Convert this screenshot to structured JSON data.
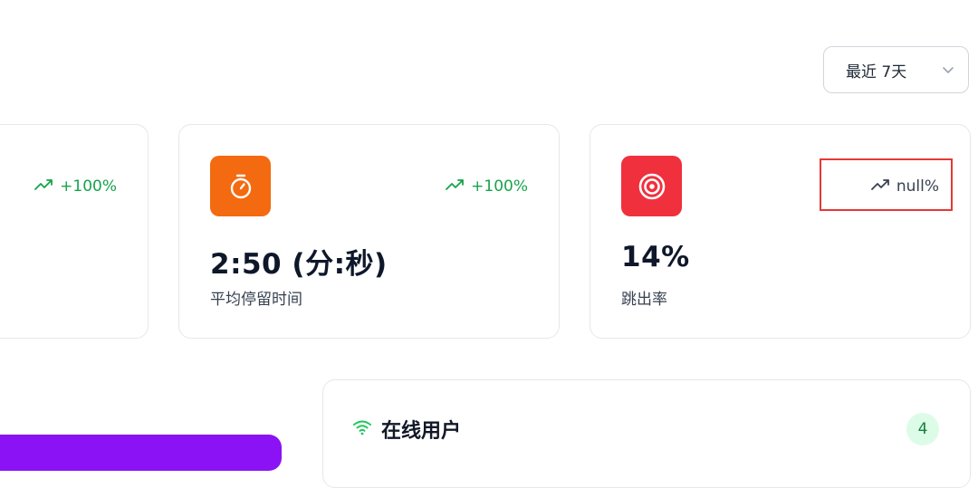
{
  "range_select": {
    "label": "最近 7天"
  },
  "cards": [
    {
      "trend": "+100%"
    },
    {
      "trend": "+100%",
      "value": "2:50 (分:秒)",
      "label": "平均停留时间"
    },
    {
      "trend": "null%",
      "value": "14%",
      "label": "跳出率"
    }
  ],
  "online": {
    "title": "在线用户",
    "count": "4"
  },
  "colors": {
    "trend_up": "#16a34a",
    "icon_orange": "#f36a10",
    "icon_red": "#f0303d",
    "highlight": "#e53935",
    "purple": "#8b12f5",
    "badge_bg": "#dcfce7"
  }
}
